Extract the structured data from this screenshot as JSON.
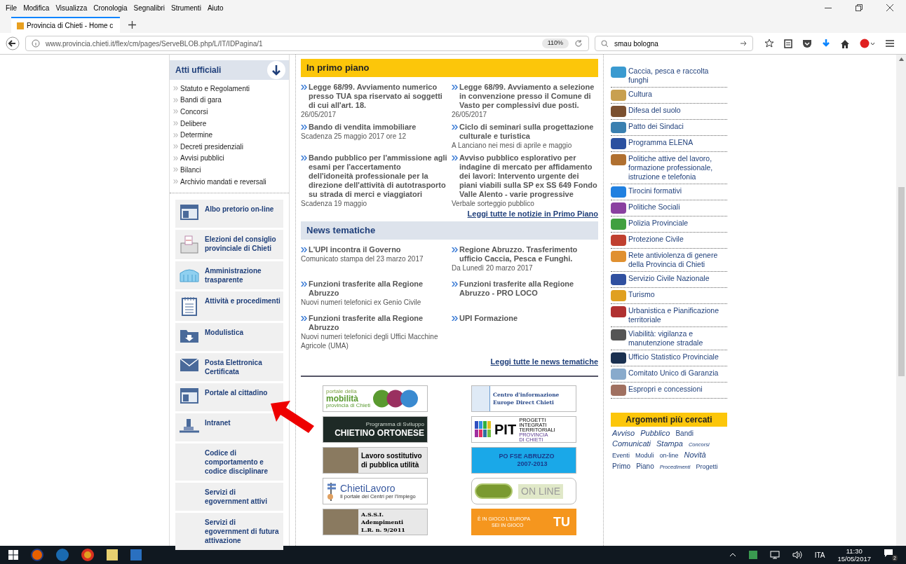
{
  "browser": {
    "menu": [
      "File",
      "Modifica",
      "Visualizza",
      "Cronologia",
      "Segnalibri",
      "Strumenti",
      "Aiuto"
    ],
    "tab": {
      "title": "Provincia di Chieti - Home c",
      "selected": true
    },
    "url": "www.provincia.chieti.it/flex/cm/pages/ServeBLOB.php/L/IT/IDPagina/1",
    "zoom": "110%",
    "search": "smau bologna"
  },
  "atti": {
    "title": "Atti ufficiali",
    "items": [
      "Statuto e Regolamenti",
      "Bandi di gara",
      "Concorsi",
      "Delibere",
      "Determine",
      "Decreti presidenziali",
      "Avvisi pubblici",
      "Bilanci",
      "Archivio mandati e reversali"
    ]
  },
  "services": [
    "Albo pretorio on-line",
    "Elezioni del consiglio provinciale di Chieti",
    "Amministrazione trasparente",
    "Attività e procedimenti",
    "Modulistica",
    "Posta Elettronica Certificata",
    "Portale al cittadino",
    "Intranet",
    "Codice di comportamento e codice disciplinare",
    "Servizi di egovernment attivi",
    "Servizi di egovernment di futura attivazione"
  ],
  "primo_piano": {
    "title": "In primo piano",
    "items": [
      {
        "title": "Legge 68/99. Avviamento numerico presso TUA spa riservato ai soggetti di cui all'art. 18.",
        "note": "26/05/2017"
      },
      {
        "title": "Legge 68/99. Avviamento a selezione in convenzione presso il Comune di Vasto per complessivi due posti.",
        "note": "26/05/2017"
      },
      {
        "title": "Bando di vendita immobiliare",
        "note": "Scadenza 25 maggio 2017 ore 12"
      },
      {
        "title": "Ciclo di seminari sulla progettazione culturale e turistica",
        "note": "A Lanciano nei mesi di aprile e maggio"
      },
      {
        "title": "Bando pubblico per l'ammissione agli esami per l'accertamento dell'idoneità professionale per la direzione dell'attività di autotrasporto su strada di merci e viaggiatori",
        "note": "Scadenza 19 maggio"
      },
      {
        "title": "Avviso pubblico esplorativo per indagine di mercato per affidamento dei lavori: Intervento urgente dei piani viabili sulla SP ex SS 649 Fondo Valle Alento - varie progressive",
        "note": "Verbale sorteggio pubblico"
      }
    ],
    "link": "Leggi tutte le notizie in Primo Piano"
  },
  "news": {
    "title": "News tematiche",
    "items": [
      {
        "title": "L'UPI incontra il Governo",
        "note": "Comunicato stampa del 23 marzo 2017"
      },
      {
        "title": "Regione Abruzzo. Trasferimento ufficio Caccia, Pesca e Funghi.",
        "note": "Da Lunedì 20 marzo 2017"
      },
      {
        "title": "Funzioni trasferite alla Regione Abruzzo",
        "note": "Nuovi numeri telefonici ex Genio Civile"
      },
      {
        "title": "Funzioni trasferite alla Regione Abruzzo - PRO LOCO"
      },
      {
        "title": "Funzioni trasferite alla Regione Abruzzo",
        "note": "Nuovi numeri telefonici degli Uffici Macchine Agricole (UMA)"
      },
      {
        "title": "UPI Formazione"
      }
    ],
    "link": "Leggi tutte le news tematiche"
  },
  "banners": [
    {
      "kind": "mobility",
      "lines": [
        "portale della",
        "mobilità",
        "provincia di Chieti"
      ]
    },
    {
      "kind": "europe",
      "lines": [
        "Centro d'informazione",
        "Europe Direct Chieti"
      ]
    },
    {
      "kind": "dark",
      "lines": [
        "Programma di Sviluppo",
        "CHIETINO ORTONESE"
      ]
    },
    {
      "kind": "pit",
      "lines": [
        "PIT",
        "PROGETTI",
        "INTEGRATI",
        "TERRITORIALI",
        "PROVINCIA",
        "DI CHIETI"
      ]
    },
    {
      "kind": "photo",
      "lines": [
        "Lavoro sostitutivo",
        "di pubblica utilità"
      ]
    },
    {
      "kind": "blue",
      "lines": [
        "PO FSE ABRUZZO",
        "2007-2013"
      ]
    },
    {
      "kind": "light",
      "lines": [
        "ChietiLavoro",
        "Il portale dei Centri per l'Impiego"
      ]
    },
    {
      "kind": "green",
      "lines": [
        "ON LINE"
      ]
    },
    {
      "kind": "photo",
      "lines": [
        "A.S.S.I.",
        "Adempimenti",
        "L.R. n. 9/2011"
      ]
    },
    {
      "kind": "orange",
      "lines": [
        "È IN GIOCO L'EUROPA",
        "SEI IN GIOCO",
        "TU"
      ]
    }
  ],
  "topics": [
    "Caccia, pesca e raccolta funghi",
    "Cultura",
    "Difesa del suolo",
    "Patto dei Sindaci",
    "Programma ELENA",
    "Politiche attive del lavoro, formazione professionale, istruzione e telefonia",
    "Tirocini formativi",
    "Politiche Sociali",
    "Polizia Provinciale",
    "Protezione Civile",
    "Rete antiviolenza di genere della Provincia di Chieti",
    "Servizio Civile Nazionale",
    "Turismo",
    "Urbanistica e Pianificazione territoriale",
    "Viabilità: vigilanza e manutenzione stradale",
    "Ufficio Statistico Provinciale",
    "Comitato Unico di Garanzia",
    "Espropri e concessioni"
  ],
  "searches": {
    "title": "Argomenti più cercati",
    "tags": [
      {
        "text": "Avviso",
        "kind": "large",
        "italic": true
      },
      {
        "text": "Pubblico",
        "kind": "large",
        "italic": true
      },
      {
        "text": "Bandi",
        "kind": "medium",
        "italic": false
      },
      {
        "text": "Comunicati",
        "kind": "large",
        "italic": true
      },
      {
        "text": "Stampa",
        "kind": "large",
        "italic": true
      },
      {
        "text": "Concorsi",
        "kind": "tiny",
        "italic": true
      },
      {
        "text": "Eventi",
        "kind": "small",
        "italic": false
      },
      {
        "text": "Moduli",
        "kind": "small",
        "italic": false
      },
      {
        "text": "on-line",
        "kind": "small",
        "italic": false
      },
      {
        "text": "Novità",
        "kind": "large",
        "italic": true
      },
      {
        "text": "Primo",
        "kind": "medium",
        "italic": false
      },
      {
        "text": "Piano",
        "kind": "medium",
        "italic": false
      },
      {
        "text": "Procedimenti",
        "kind": "tiny",
        "italic": true
      },
      {
        "text": "Progetti",
        "kind": "small",
        "italic": false
      }
    ]
  },
  "taskbar": {
    "language": "ITA",
    "time": "11:30",
    "date": "15/05/2017",
    "notifications": "2"
  }
}
